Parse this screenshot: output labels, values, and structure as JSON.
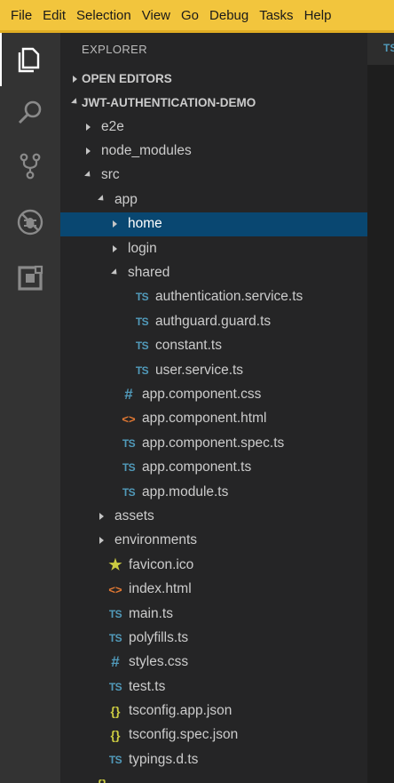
{
  "menu": {
    "items": [
      "File",
      "Edit",
      "Selection",
      "View",
      "Go",
      "Debug",
      "Tasks",
      "Help"
    ]
  },
  "activity_bar": {
    "items": [
      {
        "name": "explorer-icon",
        "active": true
      },
      {
        "name": "search-icon",
        "active": false
      },
      {
        "name": "source-control-icon",
        "active": false
      },
      {
        "name": "debug-icon",
        "active": false
      },
      {
        "name": "extensions-icon",
        "active": false
      }
    ]
  },
  "sidebar": {
    "title": "EXPLORER",
    "open_editors_label": "OPEN EDITORS",
    "project_label": "JWT-AUTHENTICATION-DEMO"
  },
  "tree": [
    {
      "label": "e2e",
      "type": "folder",
      "depth": 1,
      "expanded": false
    },
    {
      "label": "node_modules",
      "type": "folder",
      "depth": 1,
      "expanded": false
    },
    {
      "label": "src",
      "type": "folder",
      "depth": 1,
      "expanded": true
    },
    {
      "label": "app",
      "type": "folder",
      "depth": 2,
      "expanded": true
    },
    {
      "label": "home",
      "type": "folder",
      "depth": 3,
      "expanded": false,
      "selected": true
    },
    {
      "label": "login",
      "type": "folder",
      "depth": 3,
      "expanded": false
    },
    {
      "label": "shared",
      "type": "folder",
      "depth": 3,
      "expanded": true
    },
    {
      "label": "authentication.service.ts",
      "type": "ts",
      "depth": 4
    },
    {
      "label": "authguard.guard.ts",
      "type": "ts",
      "depth": 4
    },
    {
      "label": "constant.ts",
      "type": "ts",
      "depth": 4
    },
    {
      "label": "user.service.ts",
      "type": "ts",
      "depth": 4
    },
    {
      "label": "app.component.css",
      "type": "css",
      "depth": 3
    },
    {
      "label": "app.component.html",
      "type": "html",
      "depth": 3
    },
    {
      "label": "app.component.spec.ts",
      "type": "ts",
      "depth": 3
    },
    {
      "label": "app.component.ts",
      "type": "ts",
      "depth": 3
    },
    {
      "label": "app.module.ts",
      "type": "ts",
      "depth": 3
    },
    {
      "label": "assets",
      "type": "folder",
      "depth": 2,
      "expanded": false
    },
    {
      "label": "environments",
      "type": "folder",
      "depth": 2,
      "expanded": false
    },
    {
      "label": "favicon.ico",
      "type": "star",
      "depth": 2
    },
    {
      "label": "index.html",
      "type": "html",
      "depth": 2
    },
    {
      "label": "main.ts",
      "type": "ts",
      "depth": 2
    },
    {
      "label": "polyfills.ts",
      "type": "ts",
      "depth": 2
    },
    {
      "label": "styles.css",
      "type": "css",
      "depth": 2
    },
    {
      "label": "test.ts",
      "type": "ts",
      "depth": 2
    },
    {
      "label": "tsconfig.app.json",
      "type": "json",
      "depth": 2
    },
    {
      "label": "tsconfig.spec.json",
      "type": "json",
      "depth": 2
    },
    {
      "label": "typings.d.ts",
      "type": "ts",
      "depth": 2
    },
    {
      "label": "",
      "type": "json",
      "depth": 1
    }
  ],
  "icon_glyphs": {
    "ts": "TS",
    "css": "#",
    "html": "<>",
    "json": "{}",
    "star": "★"
  },
  "editor": {
    "tab_label": "TS"
  },
  "colors": {
    "menubar": "#f2c53d",
    "activity_bar": "#333333",
    "sidebar": "#252526",
    "selection": "#094771",
    "ts_icon": "#519aba",
    "html_icon": "#e37933",
    "json_icon": "#cbcb41"
  }
}
